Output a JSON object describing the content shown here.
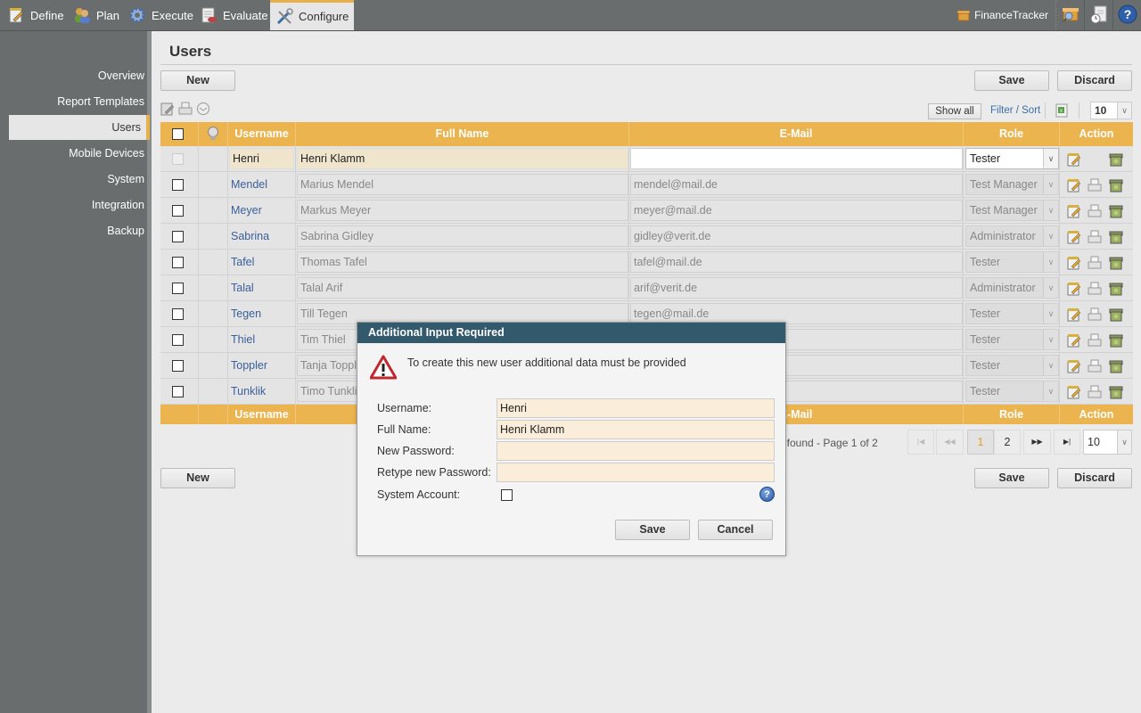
{
  "topnav": {
    "tabs": [
      {
        "label": "Define",
        "icon": "notepad-icon"
      },
      {
        "label": "Plan",
        "icon": "people-icon"
      },
      {
        "label": "Execute",
        "icon": "gear-icon"
      },
      {
        "label": "Evaluate",
        "icon": "report-chart-icon"
      },
      {
        "label": "Configure",
        "icon": "tools-icon",
        "active": true
      }
    ],
    "project": "FinanceTracker"
  },
  "sidebar": {
    "items": [
      {
        "label": "Overview"
      },
      {
        "label": "Report Templates"
      },
      {
        "label": "Users",
        "active": true
      },
      {
        "label": "Mobile Devices"
      },
      {
        "label": "System"
      },
      {
        "label": "Integration"
      },
      {
        "label": "Backup"
      }
    ]
  },
  "main": {
    "title": "Users",
    "new_label": "New",
    "save_label": "Save",
    "discard_label": "Discard",
    "show_all_label": "Show all",
    "filter_sort_label": "Filter / Sort",
    "page_size": "10"
  },
  "table": {
    "headers": {
      "username": "Username",
      "fullname": "Full Name",
      "email": "E-Mail",
      "role": "Role",
      "action": "Action"
    },
    "new_row": {
      "username": "Henri",
      "fullname": "Henri Klamm",
      "email": "",
      "role": "Tester"
    },
    "rows": [
      {
        "username": "Mendel",
        "fullname": "Marius Mendel",
        "email": "mendel@mail.de",
        "role": "Test Manager"
      },
      {
        "username": "Meyer",
        "fullname": "Markus Meyer",
        "email": "meyer@mail.de",
        "role": "Test Manager"
      },
      {
        "username": "Sabrina",
        "fullname": "Sabrina Gidley",
        "email": "gidley@verit.de",
        "role": "Administrator"
      },
      {
        "username": "Tafel",
        "fullname": "Thomas Tafel",
        "email": "tafel@mail.de",
        "role": "Tester"
      },
      {
        "username": "Talal",
        "fullname": "Talal Arif",
        "email": "arif@verit.de",
        "role": "Administrator"
      },
      {
        "username": "Tegen",
        "fullname": "Till Tegen",
        "email": "tegen@mail.de",
        "role": "Tester"
      },
      {
        "username": "Thiel",
        "fullname": "Tim Thiel",
        "email": "",
        "role": "Tester"
      },
      {
        "username": "Toppler",
        "fullname": "Tanja Toppl",
        "email": "",
        "role": "Tester"
      },
      {
        "username": "Tunklik",
        "fullname": "Timo Tunkli",
        "email": "",
        "role": "Tester"
      }
    ]
  },
  "pagination": {
    "info": "ts found - Page 1 of 2",
    "first": "|◀",
    "prev": "◀◀",
    "pages": [
      "1",
      "2"
    ],
    "current": "1",
    "next": "▶▶",
    "last": "▶|",
    "page_size": "10"
  },
  "dialog": {
    "title": "Additional Input Required",
    "message": "To create this new user additional data must be provided",
    "fields": {
      "username_label": "Username:",
      "username_value": "Henri",
      "fullname_label": "Full Name:",
      "fullname_value": "Henri Klamm",
      "password_label": "New Password:",
      "password_value": "",
      "retype_label": "Retype new Password:",
      "retype_value": "",
      "system_label": "System Account:"
    },
    "system_account_checked": false,
    "save_label": "Save",
    "cancel_label": "Cancel",
    "help_glyph": "?"
  },
  "colors": {
    "accent": "#ebb44f",
    "dialog_header": "#33596d",
    "link": "#3a5f9a",
    "chrome": "#6a6d6d"
  }
}
